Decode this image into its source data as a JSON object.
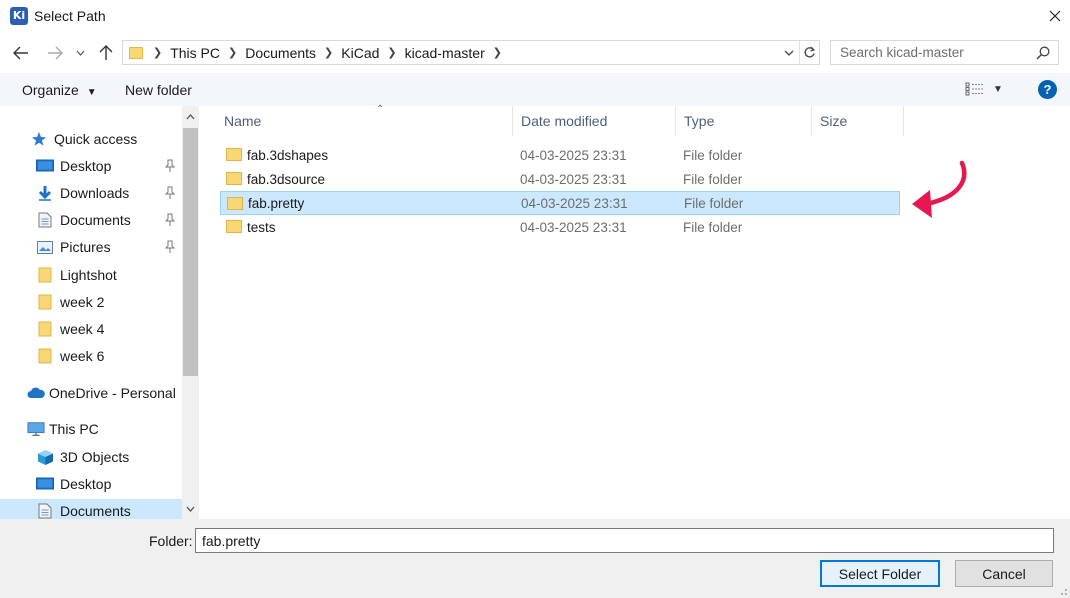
{
  "window": {
    "title": "Select Path",
    "app_icon_text": "Ki"
  },
  "address": {
    "crumbs": [
      "This PC",
      "Documents",
      "KiCad",
      "kicad-master"
    ]
  },
  "search": {
    "placeholder": "Search kicad-master"
  },
  "toolbar": {
    "organize": "Organize",
    "new_folder": "New folder",
    "help": "?"
  },
  "sidebar": {
    "items": [
      {
        "label": "Quick access",
        "icon": "star-icon",
        "indent": 0,
        "pinned": false
      },
      {
        "label": "Desktop",
        "icon": "desktop-icon",
        "indent": 1,
        "pinned": true
      },
      {
        "label": "Downloads",
        "icon": "download-icon",
        "indent": 1,
        "pinned": true
      },
      {
        "label": "Documents",
        "icon": "document-icon",
        "indent": 1,
        "pinned": true
      },
      {
        "label": "Pictures",
        "icon": "pictures-icon",
        "indent": 1,
        "pinned": true
      },
      {
        "label": "Lightshot",
        "icon": "folder-icon",
        "indent": 1,
        "pinned": false
      },
      {
        "label": "week 2",
        "icon": "folder-icon",
        "indent": 1,
        "pinned": false
      },
      {
        "label": "week 4",
        "icon": "folder-icon",
        "indent": 1,
        "pinned": false
      },
      {
        "label": "week 6",
        "icon": "folder-icon",
        "indent": 1,
        "pinned": false
      },
      {
        "label": "OneDrive - Personal",
        "icon": "cloud-icon",
        "indent": 0,
        "pinned": false
      },
      {
        "label": "This PC",
        "icon": "computer-icon",
        "indent": 0,
        "pinned": false
      },
      {
        "label": "3D Objects",
        "icon": "cube-icon",
        "indent": 1,
        "pinned": false
      },
      {
        "label": "Desktop",
        "icon": "desktop-icon",
        "indent": 1,
        "pinned": false
      },
      {
        "label": "Documents",
        "icon": "document-icon",
        "indent": 1,
        "pinned": false
      }
    ]
  },
  "columns": {
    "name": "Name",
    "date": "Date modified",
    "type": "Type",
    "size": "Size"
  },
  "files": [
    {
      "name": "fab.3dshapes",
      "date": "04-03-2025 23:31",
      "type": "File folder",
      "selected": false
    },
    {
      "name": "fab.3dsource",
      "date": "04-03-2025 23:31",
      "type": "File folder",
      "selected": false
    },
    {
      "name": "fab.pretty",
      "date": "04-03-2025 23:31",
      "type": "File folder",
      "selected": true
    },
    {
      "name": "tests",
      "date": "04-03-2025 23:31",
      "type": "File folder",
      "selected": false
    }
  ],
  "footer": {
    "folder_label": "Folder:",
    "folder_value": "fab.pretty",
    "select_button": "Select Folder",
    "cancel_button": "Cancel"
  },
  "colors": {
    "accent": "#0078d7",
    "selection": "#cce8ff",
    "annotation_arrow": "#e8174f",
    "folder": "#f8d775"
  }
}
